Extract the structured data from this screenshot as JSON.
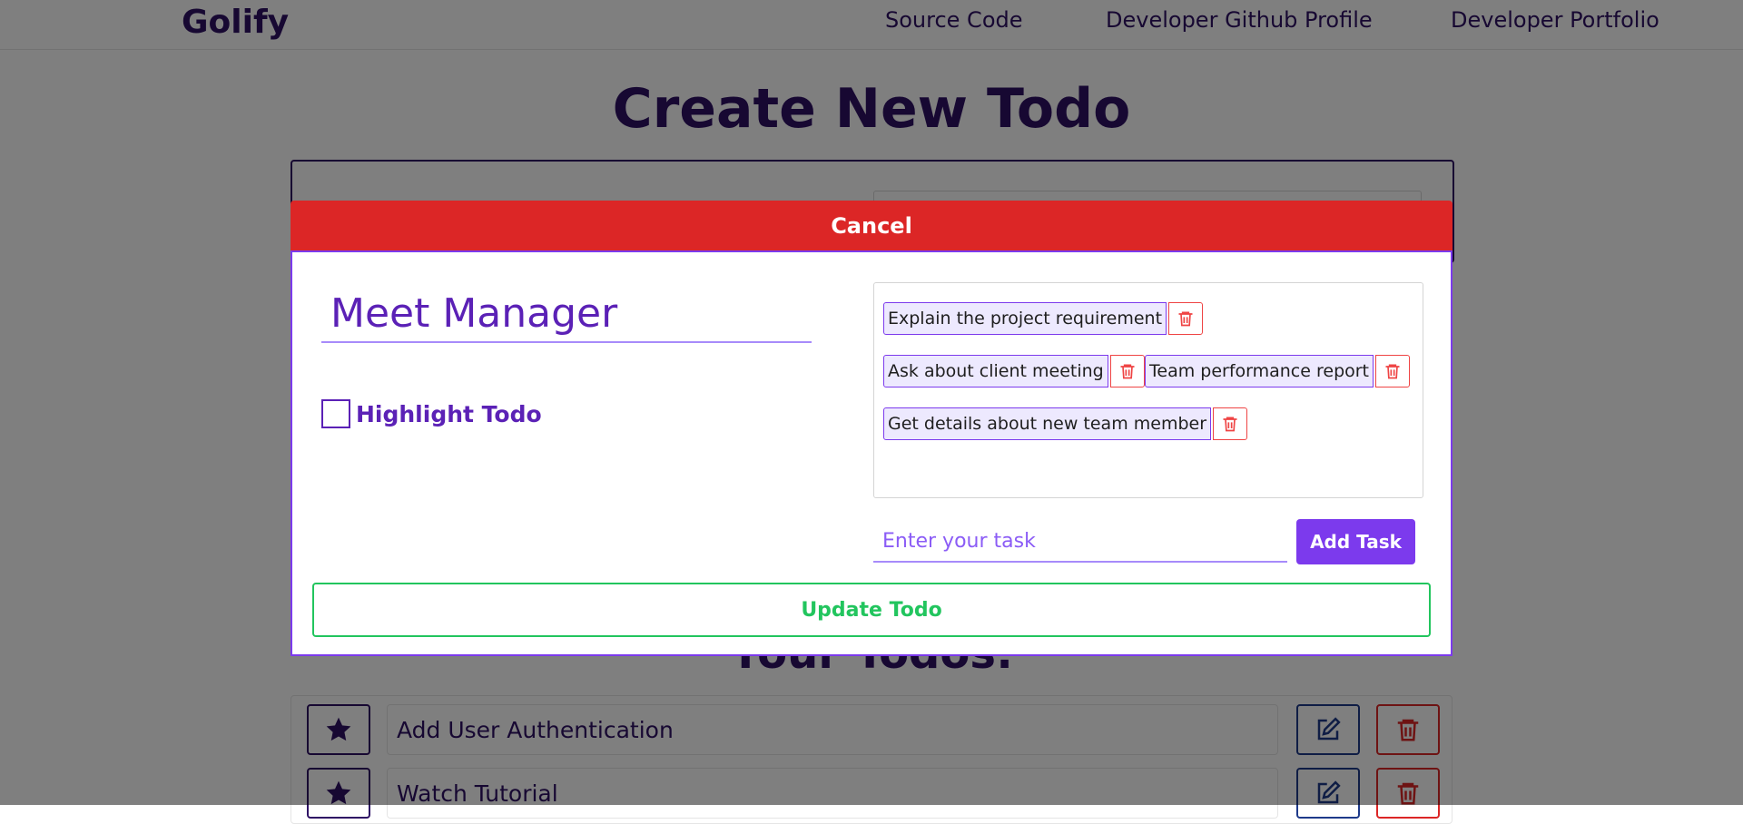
{
  "navbar": {
    "brand": "Golify",
    "links": [
      "Source Code",
      "Developer Github Profile",
      "Developer Portfolio"
    ]
  },
  "page": {
    "title": "Create New Todo",
    "todos_heading": "Your Todos:",
    "todos": [
      {
        "text": "Add User Authentication"
      },
      {
        "text": "Watch Tutorial"
      }
    ]
  },
  "modal": {
    "cancel_label": "Cancel",
    "title_value": "Meet Manager",
    "highlight_label": "Highlight Todo",
    "highlight_checked": false,
    "tasks": [
      "Explain the project requirement",
      "Ask about client meeting",
      "Team performance report",
      "Get details about new team member"
    ],
    "task_placeholder": "Enter your task",
    "add_task_label": "Add Task",
    "update_label": "Update Todo"
  },
  "colors": {
    "accent": "#7c3aed",
    "dark_purple": "#2e1065",
    "danger": "#dc2626",
    "success": "#22c55e",
    "chip_bg": "#ede9fe"
  },
  "icons": {
    "star": "star-icon",
    "edit": "edit-icon",
    "trash": "trash-icon"
  }
}
